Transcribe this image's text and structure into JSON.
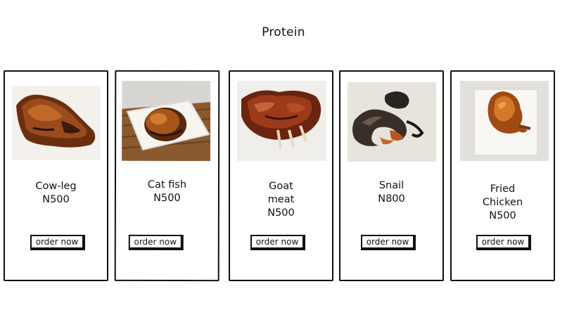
{
  "page": {
    "title": "Protein"
  },
  "items": [
    {
      "name": "Cow-leg",
      "price": "N500",
      "button_label": "order now",
      "image": "cow-leg-photo"
    },
    {
      "name": "Cat fish",
      "price": "N500",
      "button_label": "order now",
      "image": "cat-fish-photo"
    },
    {
      "name_line1": "Goat",
      "name_line2": "meat",
      "price": "N500",
      "button_label": "order now",
      "image": "goat-meat-photo"
    },
    {
      "name": "Snail",
      "price": "N800",
      "button_label": "order now",
      "image": "snail-photo"
    },
    {
      "name_line1": "Fried",
      "name_line2": "Chicken",
      "price": "N500",
      "button_label": "order now",
      "image": "fried-chicken-photo"
    }
  ]
}
